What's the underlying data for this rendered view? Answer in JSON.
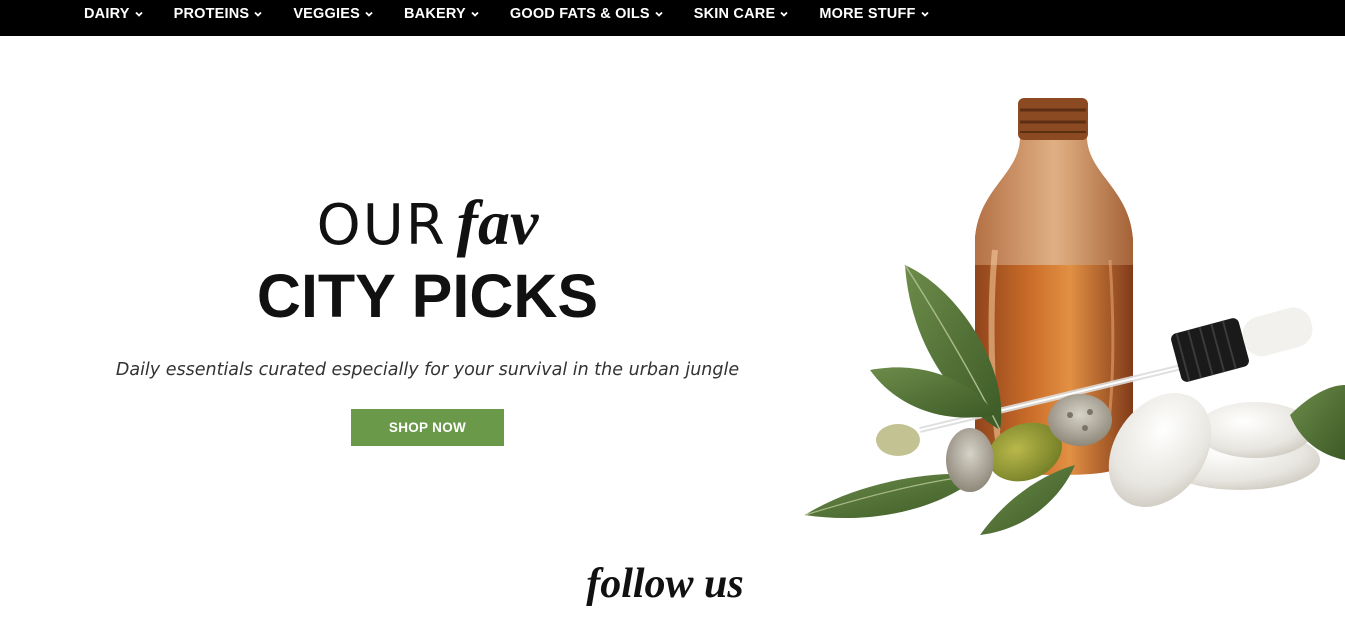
{
  "nav": {
    "items": [
      {
        "label": "DAIRY",
        "icon": "chevron-down-icon"
      },
      {
        "label": "PROTEINS",
        "icon": "chevron-down-icon"
      },
      {
        "label": "VEGGIES",
        "icon": "chevron-down-icon"
      },
      {
        "label": "BAKERY",
        "icon": "chevron-down-icon"
      },
      {
        "label": "GOOD FATS & OILS",
        "icon": "chevron-down-icon"
      },
      {
        "label": "SKIN CARE",
        "icon": "chevron-down-icon"
      },
      {
        "label": "MORE STUFF",
        "icon": "chevron-down-icon"
      }
    ]
  },
  "hero": {
    "title_word1": "OUR",
    "title_word2": "fav",
    "title_line2": "CITY PICKS",
    "subtitle": "Daily essentials curated especially for your survival in the urban jungle",
    "cta_label": "SHOP NOW",
    "image": "amber-dropper-bottle-with-leaves-acorns-and-pebbles"
  },
  "follow": {
    "heading": "follow us"
  },
  "colors": {
    "nav_background": "#000000",
    "nav_text": "#ffffff",
    "cta_background": "#6a9a49",
    "heading_text": "#111111"
  }
}
